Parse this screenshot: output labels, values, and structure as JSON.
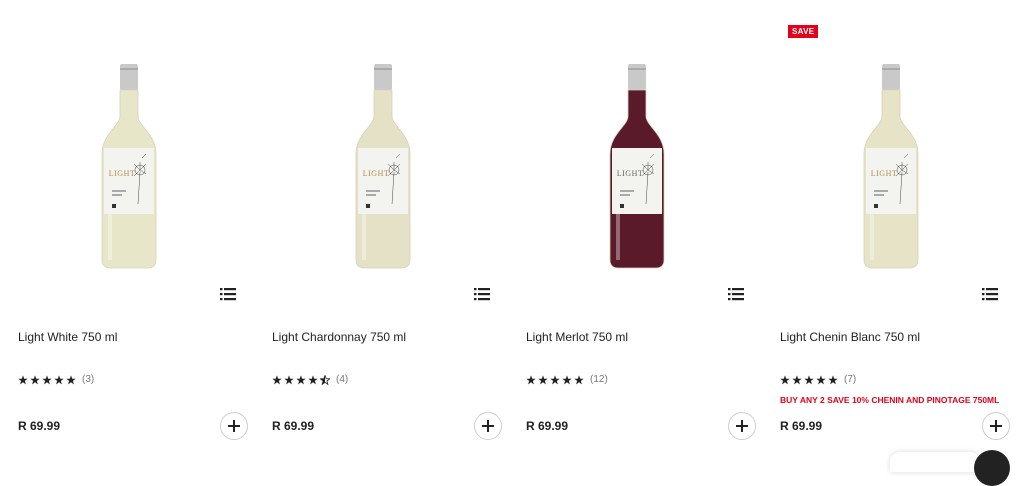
{
  "products": [
    {
      "name": "Light White 750 ml",
      "price": "R 69.99",
      "rating": 5,
      "review_count": "(3)",
      "promo": "",
      "badge": "",
      "wine_color": "#e8e6c8",
      "label_text": "LIGHT"
    },
    {
      "name": "Light Chardonnay 750 ml",
      "price": "R 69.99",
      "rating": 4.5,
      "review_count": "(4)",
      "promo": "",
      "badge": "",
      "wine_color": "#e4e1c6",
      "label_text": "LIGHT"
    },
    {
      "name": "Light Merlot 750 ml",
      "price": "R 69.99",
      "rating": 5,
      "review_count": "(12)",
      "promo": "",
      "badge": "",
      "wine_color": "#5a1a2a",
      "label_text": "LIGHT"
    },
    {
      "name": "Light Chenin Blanc 750 ml",
      "price": "R 69.99",
      "rating": 5,
      "review_count": "(7)",
      "promo": "BUY ANY 2 SAVE 10% CHENIN AND PINOTAGE 750ML",
      "badge": "SAVE",
      "wine_color": "#e6e3c6",
      "label_text": "LIGHT"
    }
  ],
  "icons": {
    "list": "list-icon",
    "add": "plus-icon",
    "star": "star-icon",
    "chat": "chat-icon"
  },
  "colors": {
    "accent": "#e2001a",
    "text": "#222222",
    "muted": "#777777"
  }
}
